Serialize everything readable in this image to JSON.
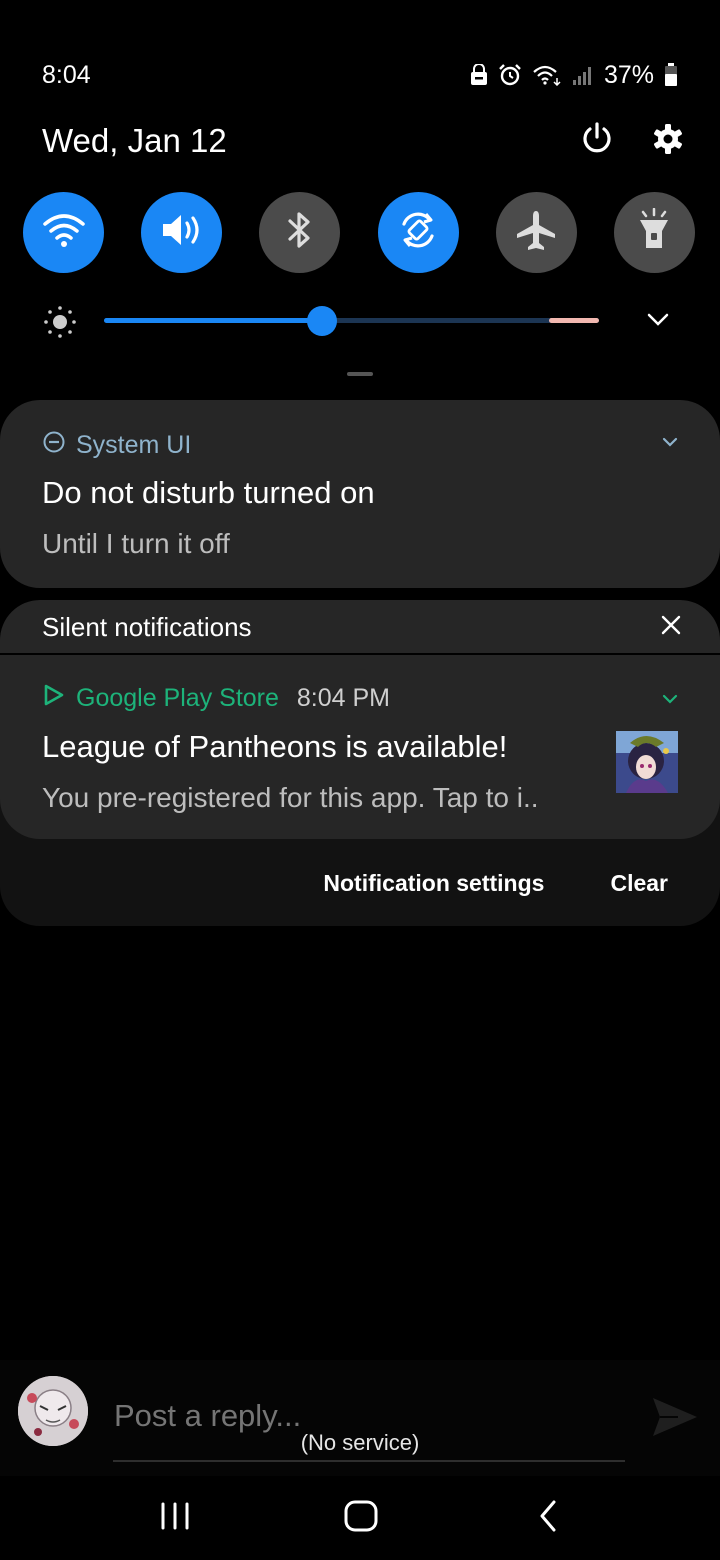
{
  "status_bar": {
    "time": "8:04",
    "battery_percent": "37%",
    "icons": [
      "dnd-lock-icon",
      "alarm-icon",
      "wifi-icon",
      "signal-icon",
      "battery-icon"
    ]
  },
  "header": {
    "date": "Wed, Jan 12",
    "icons": [
      "power-icon",
      "gear-icon"
    ]
  },
  "quick_toggles": [
    {
      "name": "wifi",
      "state": "on"
    },
    {
      "name": "sound",
      "state": "on"
    },
    {
      "name": "bluetooth",
      "state": "off"
    },
    {
      "name": "auto-rotate",
      "state": "on"
    },
    {
      "name": "airplane-mode",
      "state": "off"
    },
    {
      "name": "flashlight",
      "state": "off"
    }
  ],
  "brightness": {
    "level": 0.44
  },
  "colors": {
    "accent": "#1a87f5",
    "card": "#262626",
    "play_green": "#1db37a",
    "sysui_blue": "#8fb3cc"
  },
  "system_ui_notification": {
    "app": "System UI",
    "title": "Do not disturb turned on",
    "text": "Until I turn it off"
  },
  "silent_notifications": {
    "header": "Silent notifications",
    "play_store": {
      "app": "Google Play Store",
      "time": "8:04 PM",
      "title": "League of Pantheons is available!",
      "text": "You pre-registered for this app. Tap to i.."
    },
    "notification_settings": "Notification settings",
    "clear": "Clear"
  },
  "reply_bar": {
    "placeholder": "Post a reply...",
    "service_status": "(No service)"
  }
}
